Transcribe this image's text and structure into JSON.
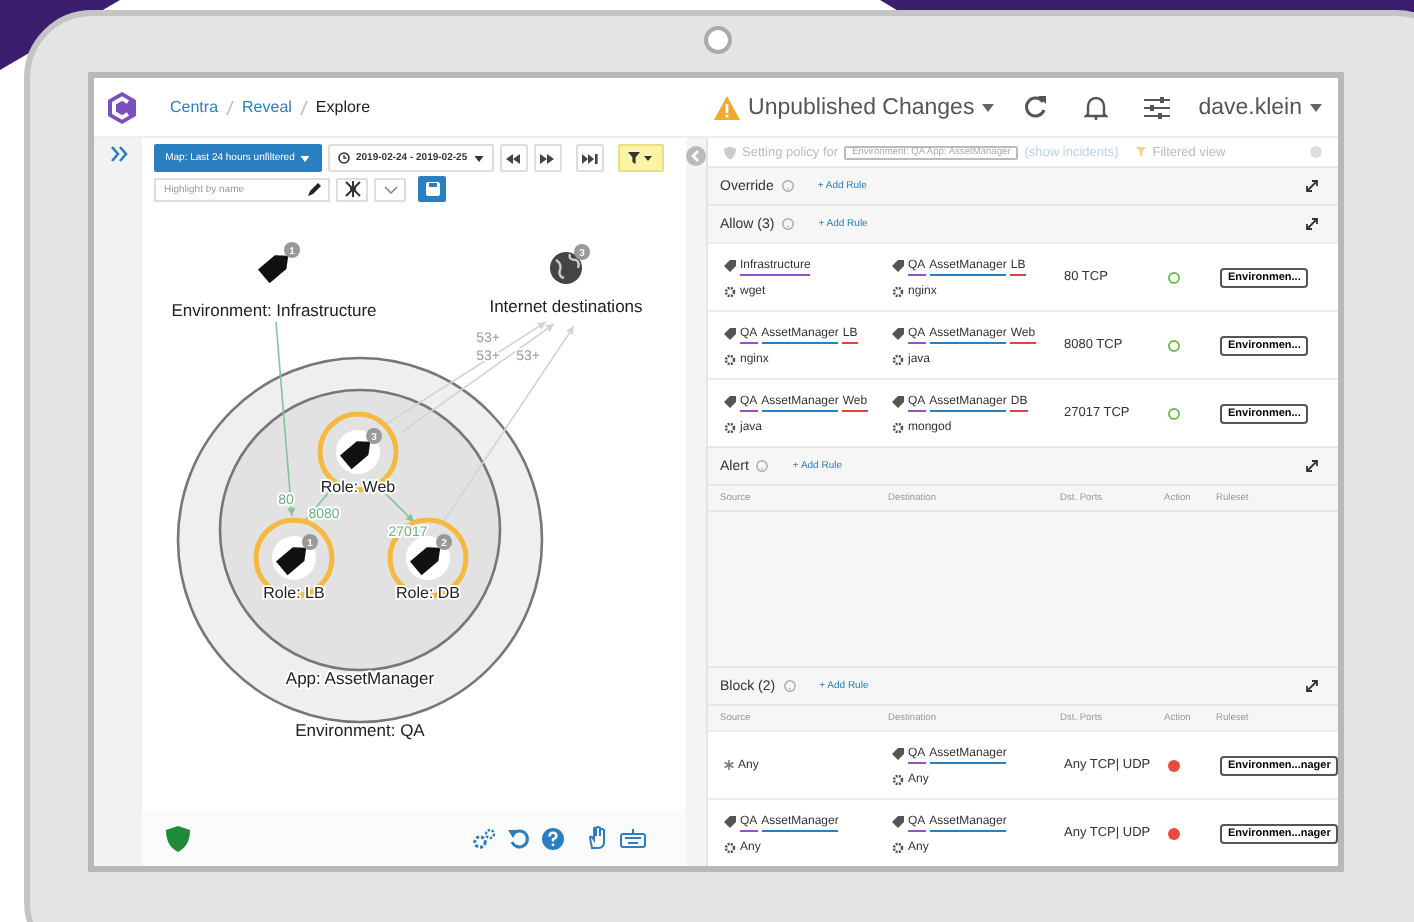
{
  "header": {
    "breadcrumbs": [
      {
        "label": "Centra",
        "current": false
      },
      {
        "label": "Reveal",
        "current": false
      },
      {
        "label": "Explore",
        "current": true
      }
    ],
    "unpublished": "Unpublished Changes",
    "user": "dave.klein"
  },
  "map_toolbar": {
    "map_filter": "Map: Last 24 hours unfiltered",
    "date_range": "2019-02-24 - 2019-02-25",
    "highlight": {
      "placeholder": "Highlight by name"
    }
  },
  "map": {
    "groups": [
      {
        "label": "App: AssetManager"
      },
      {
        "label": "Environment: QA"
      }
    ],
    "nodes": [
      {
        "kind": "tag",
        "label": "Environment: Infrastructure",
        "badge": "1"
      },
      {
        "kind": "globe",
        "label": "Internet destinations",
        "badge": "3"
      },
      {
        "kind": "role",
        "label": "Role: Web",
        "badge": "3"
      },
      {
        "kind": "role",
        "label": "Role: LB",
        "badge": "1"
      },
      {
        "kind": "role",
        "label": "Role: DB",
        "badge": "2"
      }
    ],
    "edges": [
      {
        "label": "80",
        "faded": false
      },
      {
        "label": "8080",
        "faded": false
      },
      {
        "label": "27017",
        "faded": false
      },
      {
        "label": "53+",
        "faded": true
      },
      {
        "label": "53+",
        "faded": true
      },
      {
        "label": "53+",
        "faded": true
      }
    ]
  },
  "policy": {
    "prefix": "Setting policy for",
    "scope": "Environment: QA App: AssetManager",
    "link": "(show incidents)",
    "filter": "Filtered view"
  },
  "sections": [
    {
      "kind": "override",
      "title": "Override",
      "add": "+ Add Rule"
    },
    {
      "kind": "allow",
      "title": "Allow (3)",
      "add": "+ Add Rule",
      "rows": [
        {
          "source": {
            "kind": "labels",
            "labels": [
              {
                "text": "Infrastructure",
                "color": "#9b4dca"
              }
            ],
            "process": "wget"
          },
          "destination": {
            "kind": "labels",
            "labels": [
              {
                "text": "QA",
                "color": "#9b4dca"
              },
              {
                "text": "AssetManager",
                "color": "#2a7fc1"
              },
              {
                "text": "LB",
                "color": "#e0443e"
              }
            ],
            "process": "nginx"
          },
          "ports": "80 TCP",
          "allowed": true,
          "ruleset": "Environmen..."
        },
        {
          "source": {
            "kind": "labels",
            "labels": [
              {
                "text": "QA",
                "color": "#9b4dca"
              },
              {
                "text": "AssetManager",
                "color": "#2a7fc1"
              },
              {
                "text": "LB",
                "color": "#e0443e"
              }
            ],
            "process": "nginx"
          },
          "destination": {
            "kind": "labels",
            "labels": [
              {
                "text": "QA",
                "color": "#9b4dca"
              },
              {
                "text": "AssetManager",
                "color": "#2a7fc1"
              },
              {
                "text": "Web",
                "color": "#e0443e"
              }
            ],
            "process": "java"
          },
          "ports": "8080 TCP",
          "allowed": true,
          "ruleset": "Environmen..."
        },
        {
          "source": {
            "kind": "labels",
            "labels": [
              {
                "text": "QA",
                "color": "#9b4dca"
              },
              {
                "text": "AssetManager",
                "color": "#2a7fc1"
              },
              {
                "text": "Web",
                "color": "#e0443e"
              }
            ],
            "process": "java"
          },
          "destination": {
            "kind": "labels",
            "labels": [
              {
                "text": "QA",
                "color": "#9b4dca"
              },
              {
                "text": "AssetManager",
                "color": "#2a7fc1"
              },
              {
                "text": "DB",
                "color": "#e0443e"
              }
            ],
            "process": "mongod"
          },
          "ports": "27017 TCP",
          "allowed": true,
          "ruleset": "Environmen..."
        }
      ]
    },
    {
      "kind": "alert",
      "title": "Alert",
      "add": "+ Add Rule",
      "columns": [
        "Source",
        "Destination",
        "Dst. Ports",
        "Action",
        "Ruleset"
      ]
    },
    {
      "kind": "block",
      "title": "Block (2)",
      "add": "+ Add Rule",
      "columns": [
        "Source",
        "Destination",
        "Dst. Ports",
        "Action",
        "Ruleset"
      ],
      "rows": [
        {
          "source": {
            "kind": "any",
            "text": "Any"
          },
          "destination": {
            "kind": "labels",
            "labels": [
              {
                "text": "QA",
                "color": "#9b4dca"
              },
              {
                "text": "AssetManager",
                "color": "#2a7fc1"
              }
            ],
            "process": "Any"
          },
          "ports": "Any TCP| UDP",
          "allowed": false,
          "ruleset": "Environmen...nager"
        },
        {
          "source": {
            "kind": "labels",
            "labels": [
              {
                "text": "QA",
                "color": "#9b4dca"
              },
              {
                "text": "AssetManager",
                "color": "#2a7fc1"
              }
            ],
            "process": "Any"
          },
          "destination": {
            "kind": "labels",
            "labels": [
              {
                "text": "QA",
                "color": "#9b4dca"
              },
              {
                "text": "AssetManager",
                "color": "#2a7fc1"
              }
            ],
            "process": "Any"
          },
          "ports": "Any TCP| UDP",
          "allowed": false,
          "ruleset": "Environmen...nager"
        }
      ]
    }
  ]
}
